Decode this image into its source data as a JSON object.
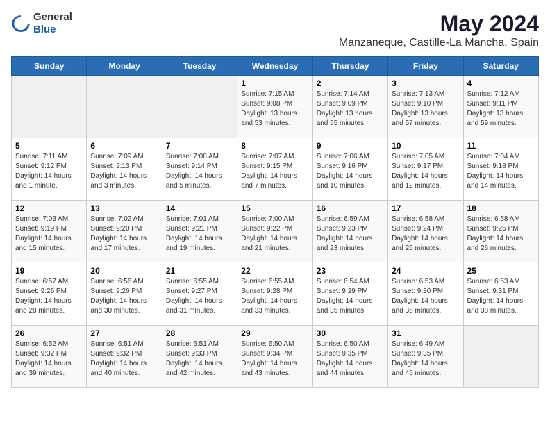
{
  "header": {
    "logo_general": "General",
    "logo_blue": "Blue",
    "title": "May 2024",
    "subtitle": "Manzaneque, Castille-La Mancha, Spain"
  },
  "days_of_week": [
    "Sunday",
    "Monday",
    "Tuesday",
    "Wednesday",
    "Thursday",
    "Friday",
    "Saturday"
  ],
  "weeks": [
    [
      {
        "day": "",
        "info": ""
      },
      {
        "day": "",
        "info": ""
      },
      {
        "day": "",
        "info": ""
      },
      {
        "day": "1",
        "info": "Sunrise: 7:15 AM\nSunset: 9:08 PM\nDaylight: 13 hours and 53 minutes."
      },
      {
        "day": "2",
        "info": "Sunrise: 7:14 AM\nSunset: 9:09 PM\nDaylight: 13 hours and 55 minutes."
      },
      {
        "day": "3",
        "info": "Sunrise: 7:13 AM\nSunset: 9:10 PM\nDaylight: 13 hours and 57 minutes."
      },
      {
        "day": "4",
        "info": "Sunrise: 7:12 AM\nSunset: 9:11 PM\nDaylight: 13 hours and 59 minutes."
      }
    ],
    [
      {
        "day": "5",
        "info": "Sunrise: 7:11 AM\nSunset: 9:12 PM\nDaylight: 14 hours and 1 minute."
      },
      {
        "day": "6",
        "info": "Sunrise: 7:09 AM\nSunset: 9:13 PM\nDaylight: 14 hours and 3 minutes."
      },
      {
        "day": "7",
        "info": "Sunrise: 7:08 AM\nSunset: 9:14 PM\nDaylight: 14 hours and 5 minutes."
      },
      {
        "day": "8",
        "info": "Sunrise: 7:07 AM\nSunset: 9:15 PM\nDaylight: 14 hours and 7 minutes."
      },
      {
        "day": "9",
        "info": "Sunrise: 7:06 AM\nSunset: 9:16 PM\nDaylight: 14 hours and 10 minutes."
      },
      {
        "day": "10",
        "info": "Sunrise: 7:05 AM\nSunset: 9:17 PM\nDaylight: 14 hours and 12 minutes."
      },
      {
        "day": "11",
        "info": "Sunrise: 7:04 AM\nSunset: 9:18 PM\nDaylight: 14 hours and 14 minutes."
      }
    ],
    [
      {
        "day": "12",
        "info": "Sunrise: 7:03 AM\nSunset: 9:19 PM\nDaylight: 14 hours and 15 minutes."
      },
      {
        "day": "13",
        "info": "Sunrise: 7:02 AM\nSunset: 9:20 PM\nDaylight: 14 hours and 17 minutes."
      },
      {
        "day": "14",
        "info": "Sunrise: 7:01 AM\nSunset: 9:21 PM\nDaylight: 14 hours and 19 minutes."
      },
      {
        "day": "15",
        "info": "Sunrise: 7:00 AM\nSunset: 9:22 PM\nDaylight: 14 hours and 21 minutes."
      },
      {
        "day": "16",
        "info": "Sunrise: 6:59 AM\nSunset: 9:23 PM\nDaylight: 14 hours and 23 minutes."
      },
      {
        "day": "17",
        "info": "Sunrise: 6:58 AM\nSunset: 9:24 PM\nDaylight: 14 hours and 25 minutes."
      },
      {
        "day": "18",
        "info": "Sunrise: 6:58 AM\nSunset: 9:25 PM\nDaylight: 14 hours and 26 minutes."
      }
    ],
    [
      {
        "day": "19",
        "info": "Sunrise: 6:57 AM\nSunset: 9:26 PM\nDaylight: 14 hours and 28 minutes."
      },
      {
        "day": "20",
        "info": "Sunrise: 6:56 AM\nSunset: 9:26 PM\nDaylight: 14 hours and 30 minutes."
      },
      {
        "day": "21",
        "info": "Sunrise: 6:55 AM\nSunset: 9:27 PM\nDaylight: 14 hours and 31 minutes."
      },
      {
        "day": "22",
        "info": "Sunrise: 6:55 AM\nSunset: 9:28 PM\nDaylight: 14 hours and 33 minutes."
      },
      {
        "day": "23",
        "info": "Sunrise: 6:54 AM\nSunset: 9:29 PM\nDaylight: 14 hours and 35 minutes."
      },
      {
        "day": "24",
        "info": "Sunrise: 6:53 AM\nSunset: 9:30 PM\nDaylight: 14 hours and 36 minutes."
      },
      {
        "day": "25",
        "info": "Sunrise: 6:53 AM\nSunset: 9:31 PM\nDaylight: 14 hours and 38 minutes."
      }
    ],
    [
      {
        "day": "26",
        "info": "Sunrise: 6:52 AM\nSunset: 9:32 PM\nDaylight: 14 hours and 39 minutes."
      },
      {
        "day": "27",
        "info": "Sunrise: 6:51 AM\nSunset: 9:32 PM\nDaylight: 14 hours and 40 minutes."
      },
      {
        "day": "28",
        "info": "Sunrise: 6:51 AM\nSunset: 9:33 PM\nDaylight: 14 hours and 42 minutes."
      },
      {
        "day": "29",
        "info": "Sunrise: 6:50 AM\nSunset: 9:34 PM\nDaylight: 14 hours and 43 minutes."
      },
      {
        "day": "30",
        "info": "Sunrise: 6:50 AM\nSunset: 9:35 PM\nDaylight: 14 hours and 44 minutes."
      },
      {
        "day": "31",
        "info": "Sunrise: 6:49 AM\nSunset: 9:35 PM\nDaylight: 14 hours and 45 minutes."
      },
      {
        "day": "",
        "info": ""
      }
    ]
  ]
}
